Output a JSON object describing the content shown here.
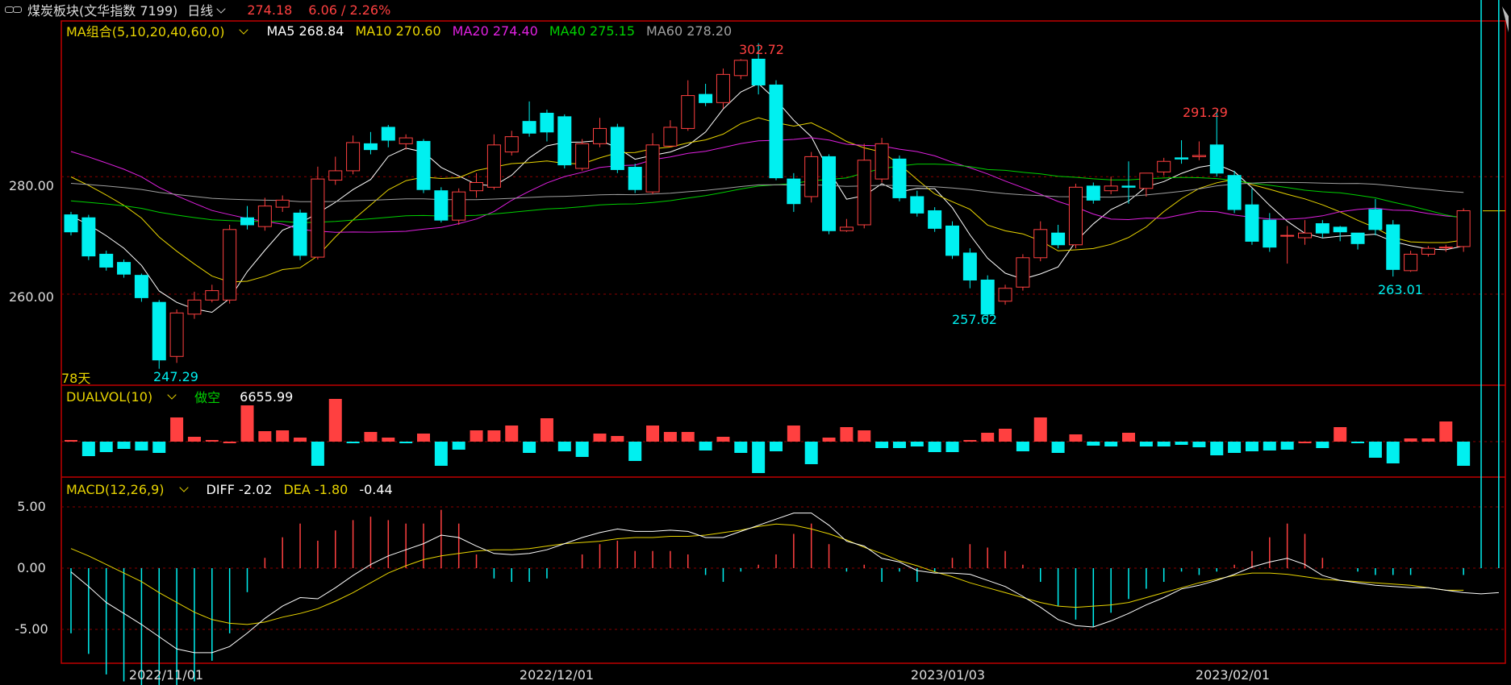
{
  "header": {
    "title": "煤炭板块(文华指数 7199)",
    "period": "日线",
    "price": "274.18",
    "change": "6.06 / 2.26%"
  },
  "colors": {
    "up": "#ff4040",
    "down": "#00f0f0",
    "ma5": "#ffffff",
    "ma10": "#e8d400",
    "ma20": "#e020e0",
    "ma40": "#00d000",
    "ma60": "#a0a0a0"
  },
  "main_panel": {
    "indicator": "MA组合(5,10,20,40,60,0)",
    "ma": [
      {
        "label": "MA5 268.84",
        "color": "#ffffff"
      },
      {
        "label": "MA10 270.60",
        "color": "#e8d400"
      },
      {
        "label": "MA20 274.40",
        "color": "#e020e0"
      },
      {
        "label": "MA40 275.15",
        "color": "#00d000"
      },
      {
        "label": "MA60 278.20",
        "color": "#a0a0a0"
      }
    ],
    "days_label": "78天",
    "y_ticks": [
      "280.00",
      "260.00"
    ],
    "extremes": {
      "high1": "302.72",
      "high2": "291.29",
      "low1": "247.29",
      "low2": "257.62",
      "low3": "263.01"
    }
  },
  "vol_panel": {
    "indicator": "DUALVOL(10)",
    "mode": "做空",
    "value": "6655.99"
  },
  "macd_panel": {
    "indicator": "MACD(12,26,9)",
    "diff": "DIFF -2.02",
    "dea": "DEA -1.80",
    "macd": "-0.44",
    "y_ticks": [
      "5.00",
      "0.00",
      "-5.00"
    ]
  },
  "x_labels": [
    "2022/11/01",
    "2022/12/01",
    "2023/01/03",
    "2023/02/01"
  ],
  "chart_data": {
    "type": "candlestick",
    "y_range": [
      244.5,
      306.5
    ],
    "candles": [
      [
        273.5,
        270.6,
        274.0,
        270.0
      ],
      [
        273.0,
        266.5,
        273.5,
        265.8
      ],
      [
        266.8,
        264.6,
        267.4,
        264.0
      ],
      [
        265.4,
        263.4,
        265.9,
        262.8
      ],
      [
        263.2,
        259.4,
        263.5,
        258.7
      ],
      [
        258.6,
        248.8,
        259.0,
        247.3
      ],
      [
        249.4,
        256.8,
        257.4,
        248.3
      ],
      [
        256.6,
        259.0,
        260.4,
        255.8
      ],
      [
        259.0,
        260.6,
        261.6,
        258.6
      ],
      [
        259.0,
        271.0,
        271.8,
        258.4
      ],
      [
        273.0,
        271.8,
        275.0,
        271.0
      ],
      [
        271.5,
        275.0,
        276.4,
        270.8
      ],
      [
        274.8,
        276.0,
        276.8,
        274.0
      ],
      [
        273.8,
        266.6,
        274.4,
        265.8
      ],
      [
        266.3,
        279.6,
        281.7,
        265.9
      ],
      [
        279.4,
        281.0,
        283.4,
        278.6
      ],
      [
        281.0,
        285.8,
        287.0,
        280.4
      ],
      [
        285.6,
        284.6,
        287.6,
        283.8
      ],
      [
        288.4,
        286.2,
        288.8,
        285.0
      ],
      [
        285.6,
        286.6,
        287.2,
        284.6
      ],
      [
        286.0,
        277.8,
        286.4,
        277.2
      ],
      [
        277.6,
        272.6,
        278.2,
        272.2
      ],
      [
        272.6,
        277.4,
        278.0,
        271.8
      ],
      [
        277.6,
        279.0,
        280.6,
        276.4
      ],
      [
        278.2,
        285.4,
        287.2,
        277.8
      ],
      [
        284.2,
        286.8,
        287.8,
        283.6
      ],
      [
        289.4,
        287.4,
        292.8,
        286.8
      ],
      [
        290.8,
        287.6,
        291.4,
        286.0
      ],
      [
        290.2,
        282.0,
        290.6,
        281.4
      ],
      [
        281.4,
        285.6,
        286.4,
        281.0
      ],
      [
        285.6,
        288.2,
        290.0,
        285.0
      ],
      [
        288.4,
        281.2,
        289.0,
        280.6
      ],
      [
        281.6,
        277.8,
        282.2,
        277.2
      ],
      [
        277.4,
        285.4,
        287.4,
        277.0
      ],
      [
        285.2,
        288.4,
        289.6,
        285.0
      ],
      [
        288.2,
        293.8,
        296.4,
        287.8
      ],
      [
        294.0,
        292.6,
        295.8,
        292.0
      ],
      [
        292.6,
        297.4,
        298.4,
        291.6
      ],
      [
        297.2,
        299.8,
        300.0,
        296.6
      ],
      [
        300.0,
        295.6,
        302.7,
        294.0
      ],
      [
        295.6,
        279.8,
        296.4,
        279.4
      ],
      [
        279.6,
        275.4,
        280.6,
        274.0
      ],
      [
        276.6,
        283.4,
        284.2,
        275.6
      ],
      [
        283.4,
        270.8,
        283.8,
        270.2
      ],
      [
        270.8,
        271.4,
        272.8,
        270.6
      ],
      [
        271.8,
        282.8,
        285.6,
        271.2
      ],
      [
        279.6,
        285.6,
        286.6,
        279.0
      ],
      [
        283.0,
        276.4,
        283.6,
        275.8
      ],
      [
        276.6,
        273.8,
        277.6,
        273.2
      ],
      [
        274.2,
        271.2,
        274.8,
        270.6
      ],
      [
        271.6,
        266.6,
        272.4,
        266.0
      ],
      [
        267.0,
        262.4,
        267.8,
        261.0
      ],
      [
        262.4,
        256.6,
        263.2,
        255.6
      ],
      [
        258.8,
        261.0,
        261.6,
        258.2
      ],
      [
        261.2,
        266.2,
        266.8,
        260.6
      ],
      [
        266.2,
        271.0,
        272.4,
        265.6
      ],
      [
        270.4,
        268.4,
        271.8,
        267.8
      ],
      [
        268.4,
        278.2,
        278.8,
        267.8
      ],
      [
        278.4,
        276.0,
        279.0,
        275.4
      ],
      [
        277.6,
        278.4,
        280.0,
        277.0
      ],
      [
        278.4,
        278.2,
        282.6,
        275.4
      ],
      [
        278.0,
        280.6,
        280.6,
        276.6
      ],
      [
        280.8,
        282.6,
        283.2,
        280.2
      ],
      [
        283.2,
        283.0,
        286.2,
        282.2
      ],
      [
        283.4,
        283.6,
        286.0,
        282.8
      ],
      [
        285.4,
        280.6,
        291.3,
        280.0
      ],
      [
        280.2,
        274.4,
        281.0,
        273.8
      ],
      [
        275.2,
        269.0,
        278.0,
        268.4
      ],
      [
        272.6,
        268.0,
        273.8,
        267.2
      ],
      [
        270.0,
        270.0,
        271.6,
        265.2
      ],
      [
        269.6,
        270.4,
        272.6,
        268.4
      ],
      [
        272.0,
        270.4,
        272.6,
        269.6
      ],
      [
        271.4,
        270.6,
        271.6,
        269.0
      ],
      [
        270.4,
        268.6,
        270.4,
        267.6
      ],
      [
        274.4,
        271.0,
        276.2,
        270.0
      ],
      [
        271.8,
        264.2,
        272.6,
        263.0
      ],
      [
        264.0,
        266.8,
        267.4,
        263.8
      ],
      [
        266.8,
        267.8,
        268.2,
        266.4
      ],
      [
        268.0,
        268.0,
        268.4,
        267.2
      ],
      [
        268.1,
        274.2,
        274.6,
        267.2
      ]
    ],
    "vol": [
      0.2,
      -1.8,
      -1.3,
      -0.9,
      -1.1,
      -1.4,
      3.0,
      0.6,
      0.2,
      0.0,
      4.5,
      1.3,
      1.4,
      0.5,
      -3.0,
      5.3,
      -0.2,
      1.2,
      0.5,
      -0.2,
      1.0,
      -3.0,
      -1.0,
      1.4,
      1.4,
      2.0,
      -1.4,
      2.9,
      -1.2,
      -1.9,
      1.0,
      0.7,
      -2.4,
      2.0,
      1.2,
      1.2,
      -1.1,
      0.6,
      -1.4,
      -3.9,
      -1.2,
      2.0,
      -2.8,
      0.5,
      1.8,
      1.4,
      -0.8,
      -0.8,
      -0.6,
      -1.3,
      -1.3,
      0.2,
      1.1,
      1.6,
      -1.2,
      3.0,
      -1.4,
      0.9,
      -0.5,
      -0.6,
      1.1,
      -0.6,
      -0.6,
      -0.4,
      -0.7,
      -1.7,
      -1.4,
      -1.2,
      -1.1,
      -1.0,
      0.0,
      -0.8,
      1.8,
      -0.2,
      -2.0,
      -2.7,
      0.4,
      0.4,
      2.5,
      -3.0
    ],
    "macd_diff": [
      -0.3,
      -1.5,
      -2.8,
      -3.7,
      -4.6,
      -5.6,
      -6.6,
      -6.9,
      -6.9,
      -6.4,
      -5.3,
      -4.1,
      -3.1,
      -2.4,
      -2.5,
      -1.6,
      -0.6,
      0.3,
      1.0,
      1.5,
      2.0,
      2.7,
      2.5,
      1.8,
      1.2,
      1.1,
      1.2,
      1.5,
      2.0,
      2.5,
      2.9,
      3.2,
      3.0,
      3.0,
      3.1,
      3.0,
      2.5,
      2.5,
      3.0,
      3.5,
      4.0,
      4.5,
      4.5,
      3.5,
      2.2,
      1.8,
      0.8,
      0.5,
      -0.2,
      -0.4,
      -0.4,
      -0.5,
      -1.0,
      -1.5,
      -2.3,
      -3.2,
      -4.2,
      -4.7,
      -4.8,
      -4.3,
      -3.7,
      -3.0,
      -2.4,
      -1.7,
      -1.4,
      -1.0,
      -0.5,
      0.1,
      0.5,
      0.8,
      0.3,
      -0.6,
      -1.0,
      -1.2,
      -1.4,
      -1.5,
      -1.6,
      -1.6,
      -1.8,
      -2.0,
      -2.1,
      -2.0
    ],
    "macd_dea": [
      1.6,
      1.0,
      0.3,
      -0.4,
      -1.1,
      -2.0,
      -2.8,
      -3.6,
      -4.2,
      -4.5,
      -4.6,
      -4.4,
      -4.0,
      -3.7,
      -3.3,
      -2.7,
      -2.0,
      -1.2,
      -0.4,
      0.2,
      0.7,
      1.0,
      1.2,
      1.4,
      1.5,
      1.5,
      1.6,
      1.8,
      2.0,
      2.1,
      2.2,
      2.4,
      2.5,
      2.5,
      2.6,
      2.6,
      2.7,
      2.9,
      3.1,
      3.4,
      3.6,
      3.5,
      3.2,
      2.8,
      2.3,
      1.7,
      1.2,
      0.6,
      0.2,
      -0.3,
      -0.7,
      -1.2,
      -1.6,
      -2.0,
      -2.4,
      -2.8,
      -3.1,
      -3.2,
      -3.1,
      -3.0,
      -2.8,
      -2.4,
      -2.0,
      -1.6,
      -1.2,
      -0.9,
      -0.6,
      -0.4,
      -0.4,
      -0.5,
      -0.7,
      -0.9,
      -1.0,
      -1.1,
      -1.2,
      -1.3,
      -1.4,
      -1.6,
      -1.8,
      -1.8
    ]
  }
}
